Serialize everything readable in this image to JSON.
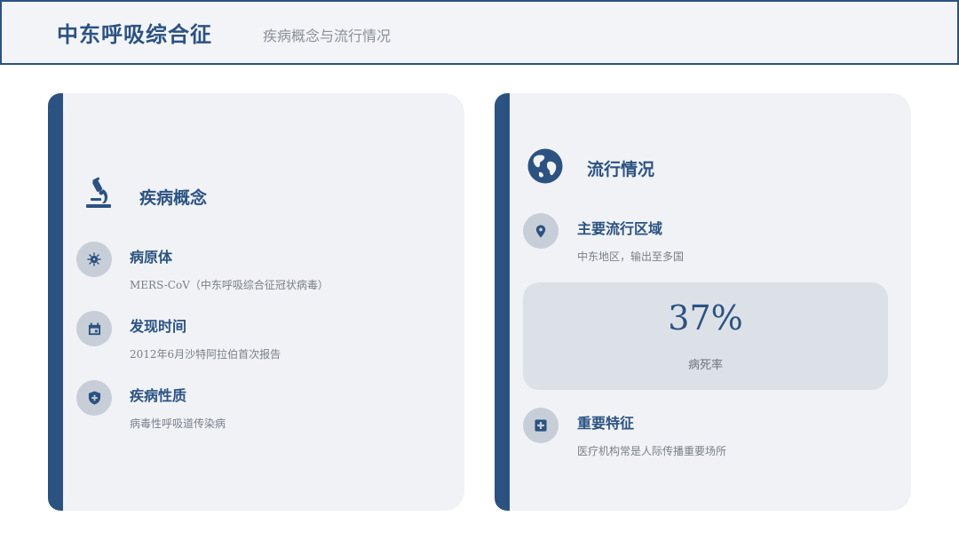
{
  "header": {
    "title": "中东呼吸综合征",
    "subtitle": "疾病概念与流行情况"
  },
  "left_card": {
    "title": "疾病概念",
    "icon": "microscope-icon",
    "items": [
      {
        "label": "病原体",
        "desc": "MERS-CoV（中东呼吸综合征冠状病毒）",
        "icon": "virus-icon"
      },
      {
        "label": "发现时间",
        "desc": "2012年6月沙特阿拉伯首次报告",
        "icon": "calendar-icon"
      },
      {
        "label": "疾病性质",
        "desc": "病毒性呼吸道传染病",
        "icon": "shield-icon"
      }
    ]
  },
  "right_card": {
    "title": "流行情况",
    "icon": "globe-icon",
    "region": {
      "label": "主要流行区域",
      "desc": "中东地区，输出至多国",
      "icon": "location-pin-icon"
    },
    "stat": {
      "value": "37%",
      "caption": "病死率"
    },
    "feature": {
      "label": "重要特征",
      "desc": "医疗机构常是人际传播重要场所",
      "icon": "medical-plus-icon"
    }
  },
  "colors": {
    "accent": "#2b5281",
    "card_bg": "#f0f2f6",
    "circle_bg": "#c8ced8",
    "stat_bg": "#dce1e7"
  }
}
